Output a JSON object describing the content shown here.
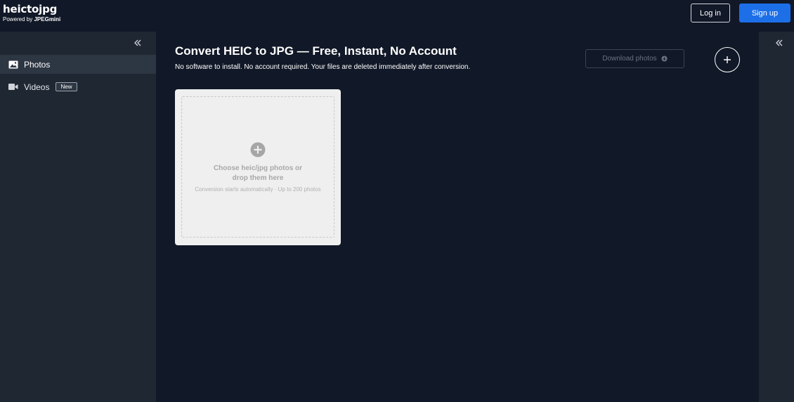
{
  "header": {
    "brand_name": "heictojpg",
    "powered_prefix": "Powered by ",
    "powered_brand": "JPEGmini",
    "login_label": "Log in",
    "signup_label": "Sign up"
  },
  "sidebar": {
    "collapse_icon": "double-chevron-left-icon",
    "items": [
      {
        "label": "Photos",
        "icon": "image-icon",
        "active": true
      },
      {
        "label": "Videos",
        "icon": "video-camera-icon",
        "badge": "New"
      }
    ]
  },
  "main": {
    "title": "Convert HEIC to JPG — Free, Instant, No Account",
    "subtitle": "No software to install. No account required. Your files are deleted immediately after conversion.",
    "download_label": "Download photos",
    "add_icon": "plus-icon",
    "upload": {
      "title": "Choose heic/jpg photos or drop them here",
      "hint": "Conversion starts automatically · Up to 200 photos",
      "icon": "plus-circle-icon"
    }
  },
  "right_panel": {
    "collapse_icon": "double-chevron-left-icon"
  },
  "colors": {
    "background": "#111827",
    "sidebar": "#1f2733",
    "accent": "#1d6fe8",
    "card": "#efefef"
  }
}
